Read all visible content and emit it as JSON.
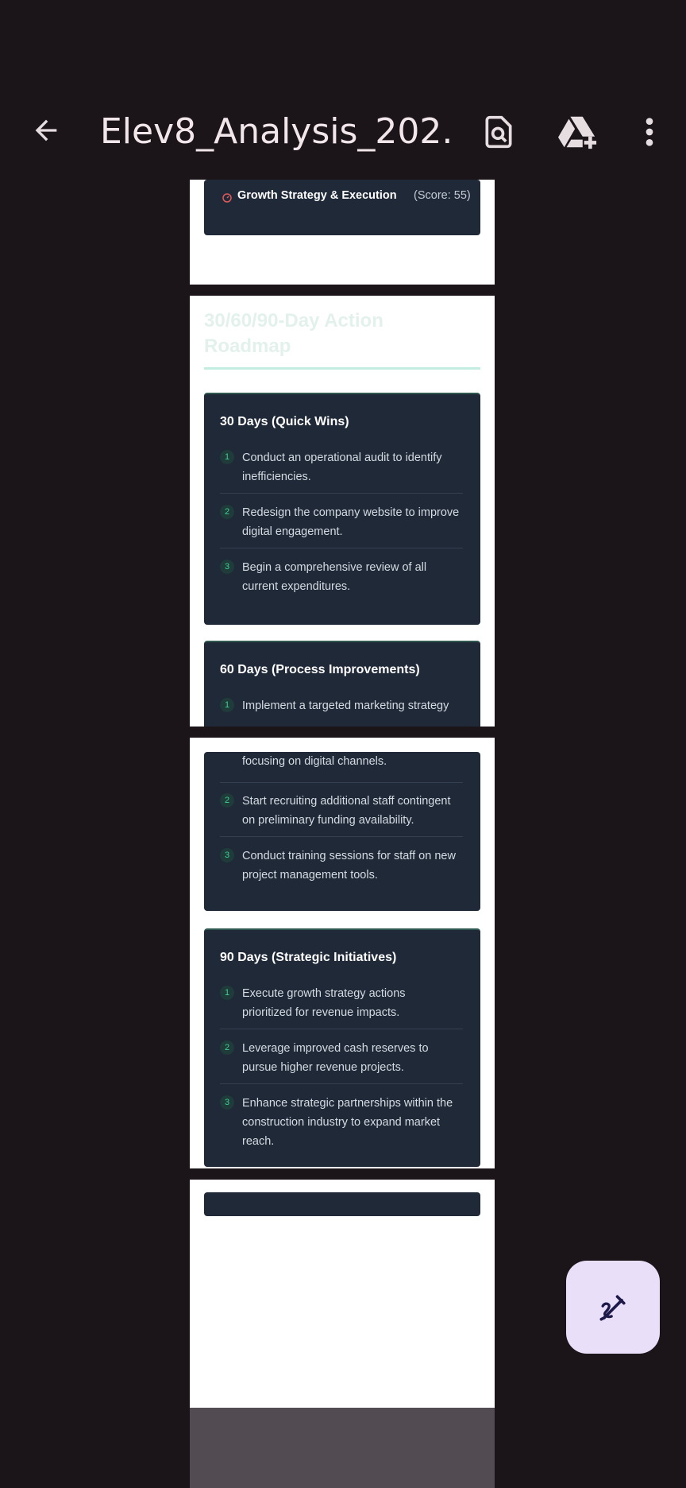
{
  "app": {
    "title": "Elev8_Analysis_202..."
  },
  "page1": {
    "card": {
      "label": "Growth Strategy & Execution",
      "score": "(Score: 55)"
    }
  },
  "page2": {
    "heading_line1": "30/60/90-Day Action",
    "heading_line2": "Roadmap",
    "card30": {
      "title": "30 Days (Quick Wins)",
      "items": [
        {
          "num": "1",
          "line1": "Conduct an operational audit to identify",
          "line2": "inefficiencies."
        },
        {
          "num": "2",
          "line1": "Redesign the company website to improve",
          "line2": "digital engagement."
        },
        {
          "num": "3",
          "line1": "Begin a comprehensive review of all",
          "line2": "current expenditures."
        }
      ]
    },
    "card60": {
      "title": "60 Days (Process Improvements)",
      "item1": {
        "num": "1",
        "line1": "Implement a targeted marketing strategy"
      }
    }
  },
  "page3": {
    "card60_cont": {
      "item1_line2": "focusing on digital channels.",
      "items": [
        {
          "num": "2",
          "line1": "Start recruiting additional staff contingent",
          "line2": "on preliminary funding availability."
        },
        {
          "num": "3",
          "line1": "Conduct training sessions for staff on new",
          "line2": "project management tools."
        }
      ]
    },
    "card90": {
      "title": "90 Days (Strategic Initiatives)",
      "items": [
        {
          "num": "1",
          "line1": "Execute growth strategy actions",
          "line2": "prioritized for revenue impacts."
        },
        {
          "num": "2",
          "line1": "Leverage improved cash reserves to",
          "line2": "pursue higher revenue projects."
        },
        {
          "num": "3",
          "line1": "Enhance strategic partnerships within the",
          "line2": "construction industry to expand market",
          "line3": "reach."
        }
      ]
    }
  },
  "icons": {
    "back": "arrow-back-icon",
    "find": "find-in-page-icon",
    "drive": "drive-add-icon",
    "more": "more-vert-icon",
    "edit": "edit-pen-icon",
    "score": "gauge-icon"
  },
  "colors": {
    "background": "#1b1418",
    "card": "#1f2938",
    "accent": "#3fcf93",
    "fab": "#e9dff9"
  }
}
